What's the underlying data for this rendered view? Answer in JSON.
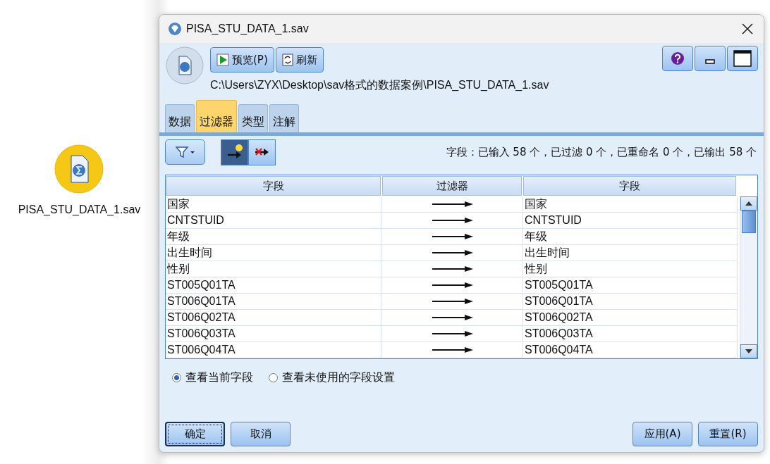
{
  "canvas": {
    "node_label": "PISA_STU_DATA_1.sav"
  },
  "window": {
    "title": "PISA_STU_DATA_1.sav"
  },
  "toolbar": {
    "buttons": [
      {
        "kind": "preview",
        "label": "预览(P)"
      },
      {
        "kind": "refresh",
        "label": "刷新"
      }
    ],
    "path": "C:\\Users\\ZYX\\Desktop\\sav格式的数据案例\\PISA_STU_DATA_1.sav"
  },
  "tabs": [
    {
      "label": "数据",
      "selected": false
    },
    {
      "label": "过滤器",
      "selected": true
    },
    {
      "label": "类型",
      "selected": false
    },
    {
      "label": "注解",
      "selected": false
    }
  ],
  "filter_toggles": [
    {
      "kind": "pass",
      "selected": true
    },
    {
      "kind": "remove",
      "selected": false
    }
  ],
  "summary": "字段：已输入 58 个，已过滤 0 个，已重命名 0 个，已输出 58 个",
  "table": {
    "columns": [
      "字段",
      "过滤器",
      "字段"
    ],
    "rows": [
      {
        "field": "国家",
        "filtered": false,
        "output": "国家"
      },
      {
        "field": "CNTSTUID",
        "filtered": false,
        "output": "CNTSTUID"
      },
      {
        "field": "年级",
        "filtered": false,
        "output": "年级"
      },
      {
        "field": "出生时间",
        "filtered": false,
        "output": "出生时间"
      },
      {
        "field": "性别",
        "filtered": false,
        "output": "性别"
      },
      {
        "field": "ST005Q01TA",
        "filtered": false,
        "output": "ST005Q01TA"
      },
      {
        "field": "ST006Q01TA",
        "filtered": false,
        "output": "ST006Q01TA"
      },
      {
        "field": "ST006Q02TA",
        "filtered": false,
        "output": "ST006Q02TA"
      },
      {
        "field": "ST006Q03TA",
        "filtered": false,
        "output": "ST006Q03TA"
      },
      {
        "field": "ST006Q04TA",
        "filtered": false,
        "output": "ST006Q04TA"
      }
    ]
  },
  "view_options": [
    {
      "label": "查看当前字段",
      "selected": true
    },
    {
      "label": "查看未使用的字段设置",
      "selected": false
    }
  ],
  "buttons_left": [
    "确定",
    "取消"
  ],
  "buttons_right": [
    "应用(A)",
    "重置(R)"
  ]
}
